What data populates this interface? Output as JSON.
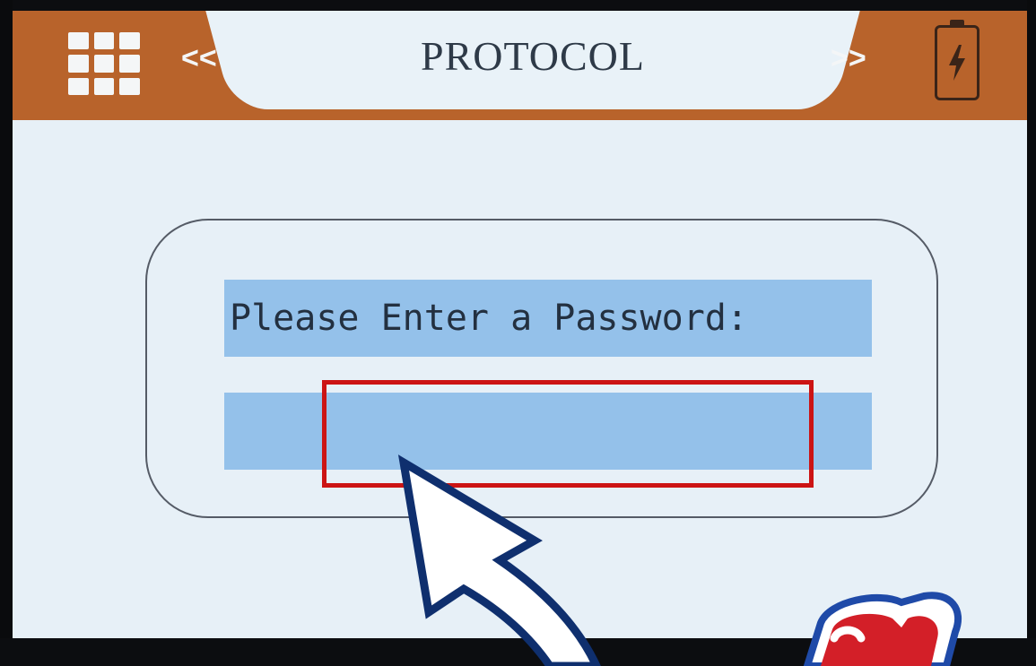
{
  "header": {
    "title": "PROTOCOL",
    "prev_label": "<<",
    "next_label": ">>",
    "menu_icon": "grid-menu-icon",
    "battery_icon": "battery-charging-icon"
  },
  "dialog": {
    "prompt": "Please Enter a Password:",
    "password_value": ""
  },
  "annotations": {
    "highlight_color": "#cc1414",
    "arrow_color": "#0f2f6e"
  },
  "colors": {
    "header_bg": "#b8632b",
    "screen_bg": "#e7f0f7",
    "field_bg": "#94c1ea"
  }
}
